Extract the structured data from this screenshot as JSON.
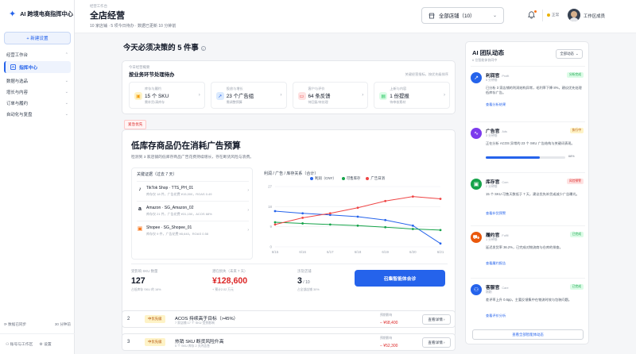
{
  "app": {
    "name": "AI 跨境电商指挥中心"
  },
  "sidebar": {
    "new_button": "+ 新建设置",
    "workbench": "经营工作台",
    "active_item": "指挥中心",
    "groups": [
      "数据与选品",
      "增长与内容",
      "订单与履约",
      "自动化与复盘"
    ],
    "sync_label": "数据已同步",
    "sync_time": "30 分钟前",
    "foot_left": "账号与工作区",
    "foot_right": "设置"
  },
  "header": {
    "breadcrumb": "经营工作台",
    "title": "全店经营",
    "subline": "10 家店铺 · 5 项今日待办 · 数据已更新 10 分钟前",
    "store_select": "全部店铺（10）",
    "status": "正常",
    "username": "工作区成员"
  },
  "main": {
    "section_title": "今天必须决策的 5 件事",
    "todo": {
      "label": "今日经营概要",
      "title": "按业务环节处理待办",
      "note": "关键经营指标，按优先级排序",
      "tiles": [
        {
          "label": "库存与履约",
          "value": "15 个 SKU",
          "sub": "需补货/清库存",
          "icon": "box-icon",
          "color": "#f59e0b",
          "bg": "#fef3c7"
        },
        {
          "label": "投放与增长",
          "value": "23 个广告组",
          "sub": "需调整预算",
          "icon": "trend-icon",
          "color": "#2563eb",
          "bg": "#dbeafe"
        },
        {
          "label": "客户与评价",
          "value": "64 条反馈",
          "sub": "待回复/待处理",
          "icon": "chat-icon",
          "color": "#ef4444",
          "bg": "#fee2e2"
        },
        {
          "label": "上新与内容",
          "value": "1 份提报",
          "sub": "待审核素材",
          "icon": "doc-icon",
          "color": "#22c55e",
          "bg": "#dcfce7"
        }
      ]
    },
    "urgent_tag": "紧急优先",
    "feature": {
      "title": "低库存商品仍在消耗广告预算",
      "desc": "检测到 3 家店铺的低库存商品广告花费持续增长，存在断货风险与浪费。",
      "evidence_title": "关键证据（过去 7 天）",
      "evidence": [
        {
          "logo": "♪",
          "logo_color": "#111827",
          "name": "TikTok Shop · TTS_PH_01",
          "sub": "库存仅 18 件，广告花费 ¥15,000，ROAS 0.49"
        },
        {
          "logo": "a",
          "logo_color": "#111827",
          "name": "Amazon · SG_Amazon_02",
          "sub": "库存仅 21 件，广告花费 ¥31,150，ACOS 68%"
        },
        {
          "logo": "▣",
          "logo_color": "#f97316",
          "name": "Shopee · SG_Shopee_01",
          "sub": "库存仅 9 件，广告花费 ¥8,640，ROAS 0.58"
        }
      ],
      "chart_title": "利润 / 广告 / 库存关系（合计）",
      "metrics": [
        {
          "label": "受影响 SKU 数量",
          "value": "127",
          "sub": "占低库存 SKU 的 16%"
        },
        {
          "label": "潜在损失（未来 7 天）",
          "value": "¥128,600",
          "sub": "+ 预计2.02 万元"
        },
        {
          "label": "涉及店铺",
          "value": "3",
          "value_suffix": " / 10",
          "sub": "占全部店铺 30%"
        }
      ],
      "cta": "召集智能体会诊"
    },
    "items": [
      {
        "num": "2",
        "tag": "中优先级",
        "title": "ACOS 持续高于目标（>45%）",
        "sub": "7 家店铺 17 个 SKU 受到影响",
        "val_label": "预期影响",
        "value": "− ¥68,400",
        "btn": "查看详情 ›"
      },
      {
        "num": "3",
        "tag": "中优先级",
        "title": "热销 SKU 断货风险升高",
        "sub": "5 个 SKU 库存 2 天内告急",
        "val_label": "预期影响",
        "value": "− ¥52,300",
        "btn": "查看详情 ›"
      }
    ]
  },
  "team": {
    "title": "AI 团队动态",
    "sub": "6 位智能体协同中",
    "filter": "全部动态",
    "agents": [
      {
        "name": "利润官",
        "en": "Profit",
        "time": "5 分钟前",
        "badge": "分析完成",
        "badge_color": "#16a34a",
        "badge_bg": "#dcfce7",
        "icon": "trend-up-icon",
        "color": "#2563eb",
        "text": "已分析 3 家店铺的利润结构异常，毛利率下降 8%，建议优先处理低库存广告。",
        "link": "查看分析结果"
      },
      {
        "name": "广告官",
        "en": "Ads",
        "time": "3 分钟前",
        "badge": "执行中",
        "badge_color": "#b45309",
        "badge_bg": "#fef3c7",
        "icon": "pulse-icon",
        "color": "#7c3aed",
        "text": "正在分析 ACOS 异常的 23 个 SKU 广告结构与关键词表现。",
        "progress": 0.68,
        "progress_label": "68%"
      },
      {
        "name": "库存官",
        "en": "Com",
        "time": "2 分钟前",
        "badge": "风险预警",
        "badge_color": "#dc2626",
        "badge_bg": "#fee2e2",
        "icon": "box-icon",
        "color": "#16a34a",
        "text": "15 个 SKU 可售天数低于 7 天，建议优先补货或减少广告曝光。",
        "link": "查看补货预警"
      },
      {
        "name": "履约官",
        "en": "Fulfil",
        "time": "1 分钟前",
        "badge": "已完成",
        "badge_color": "#16a34a",
        "badge_bg": "#dcfce7",
        "icon": "truck-icon",
        "color": "#ea580c",
        "text": "延迟发货率 36.2%，已完成对物流商与仓库的排查。",
        "link": "查看履约报告"
      },
      {
        "name": "客服官",
        "en": "Care",
        "time": "刚刚",
        "badge": "已完成",
        "badge_color": "#16a34a",
        "badge_bg": "#dcfce7",
        "icon": "users-icon",
        "color": "#2563eb",
        "text": "差评率上升 0.6pp，主要反馈集中在物流时效与包装问题。",
        "link": "查看评价分析"
      }
    ],
    "all_button": "查看全部智能体动态"
  },
  "chart_data": {
    "type": "line",
    "title": "利润 / 广告 / 库存关系（合计）",
    "categories": [
      "6/15",
      "6/16",
      "6/17",
      "6/18",
      "6/19",
      "6/20",
      "6/21"
    ],
    "ylim": [
      0,
      27
    ],
    "yticks": [
      27,
      18,
      9,
      0
    ],
    "series": [
      {
        "name": "利润（CNY）",
        "color": "#2563eb",
        "values": [
          16,
          15,
          14.3,
          13.5,
          12,
          9.5,
          1.5
        ]
      },
      {
        "name": "可售库存",
        "color": "#16a34a",
        "values": [
          11,
          10.5,
          10,
          9.5,
          8.8,
          8,
          7.5
        ]
      },
      {
        "name": "广告日消",
        "color": "#ef4444",
        "values": [
          10,
          13,
          15,
          17.5,
          20.5,
          22.5,
          21.5
        ]
      }
    ]
  }
}
